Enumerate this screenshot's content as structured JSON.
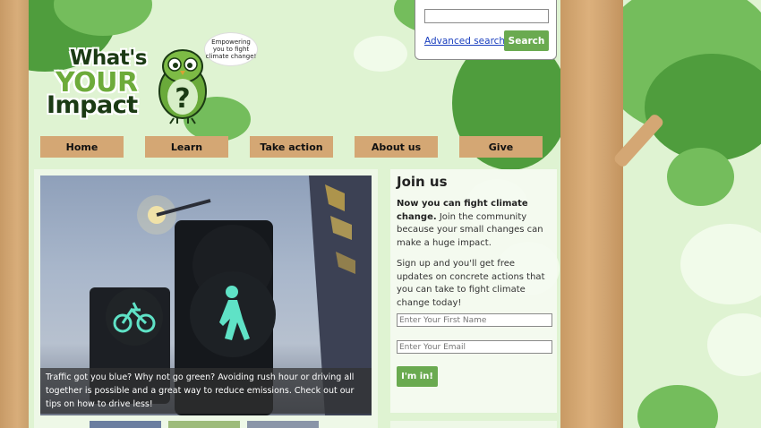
{
  "search": {
    "value": "",
    "advanced_label": "Advanced search",
    "button_label": "Search"
  },
  "logo": {
    "line1": "What's",
    "line2": "YOUR",
    "line3": "Impact",
    "bubble": "Empowering you to fight climate change!"
  },
  "nav": {
    "items": [
      {
        "label": "Home"
      },
      {
        "label": "Learn"
      },
      {
        "label": "Take action"
      },
      {
        "label": "About us"
      },
      {
        "label": "Give"
      }
    ]
  },
  "slideshow": {
    "caption": "Traffic got you blue? Why not go green? Avoiding rush hour or driving all together is possible and a great way to reduce emissions. Check out our tips on how to drive less!"
  },
  "join": {
    "title": "Join us",
    "lead_bold": "Now you can fight climate change.",
    "lead_rest": " Join the community because your small changes can make a huge impact.",
    "paragraph2": "Sign up and you'll get free updates on concrete actions that you can take to fight climate change today!",
    "first_name_placeholder": "Enter Your First Name",
    "email_placeholder": "Enter Your Email",
    "button_label": "I'm in!"
  },
  "colors": {
    "background": "#dff3d2",
    "nav_tab": "#d4a774",
    "button_green": "#6aaa50",
    "link_blue": "#1a3fbf"
  }
}
